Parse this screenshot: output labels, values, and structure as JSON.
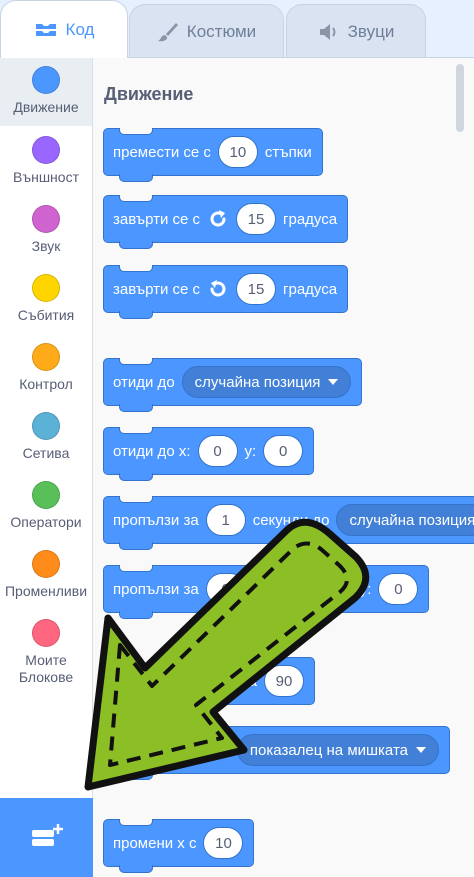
{
  "tabs": [
    {
      "label": "Код",
      "icon": "code-icon"
    },
    {
      "label": "Костюми",
      "icon": "brush-icon"
    },
    {
      "label": "Звуци",
      "icon": "speaker-icon"
    }
  ],
  "categories": [
    {
      "label": "Движение",
      "color": "#4c97ff"
    },
    {
      "label": "Външност",
      "color": "#9966ff"
    },
    {
      "label": "Звук",
      "color": "#cf63cf"
    },
    {
      "label": "Събития",
      "color": "#ffd500"
    },
    {
      "label": "Контрол",
      "color": "#ffab19"
    },
    {
      "label": "Сетива",
      "color": "#5cb1d6"
    },
    {
      "label": "Оператори",
      "color": "#59c059"
    },
    {
      "label": "Променливи",
      "color": "#ff8c1a"
    },
    {
      "label": "Моите\nБлокове",
      "color": "#ff6680"
    }
  ],
  "palette": {
    "section_title": "Движение",
    "blocks": {
      "move": {
        "text1": "премести се с",
        "value": "10",
        "text2": "стъпки"
      },
      "turn_right": {
        "text1": "завърти се с",
        "value": "15",
        "text2": "градуса"
      },
      "turn_left": {
        "text1": "завърти се с",
        "value": "15",
        "text2": "градуса"
      },
      "goto": {
        "text1": "отиди до",
        "dropdown": "случайна позиция"
      },
      "goto_xy": {
        "text1": "отиди до x:",
        "x": "0",
        "text2": "y:",
        "y": "0"
      },
      "glide": {
        "text1": "пропълзи за",
        "value": "1",
        "text2": "секунди до",
        "dropdown": "случайна позиция"
      },
      "glide_xy": {
        "text1": "пропълзи за",
        "x": "0",
        "text2": "y:",
        "y": "0"
      },
      "point_dir": {
        "text1": "ка",
        "value": "90"
      },
      "point_towards": {
        "dropdown": "показалец на мишката"
      },
      "change_x": {
        "text1": "промени x с",
        "value": "10"
      }
    }
  },
  "colors": {
    "motion": "#4c97ff",
    "arrow_green": "#8cbf26"
  }
}
